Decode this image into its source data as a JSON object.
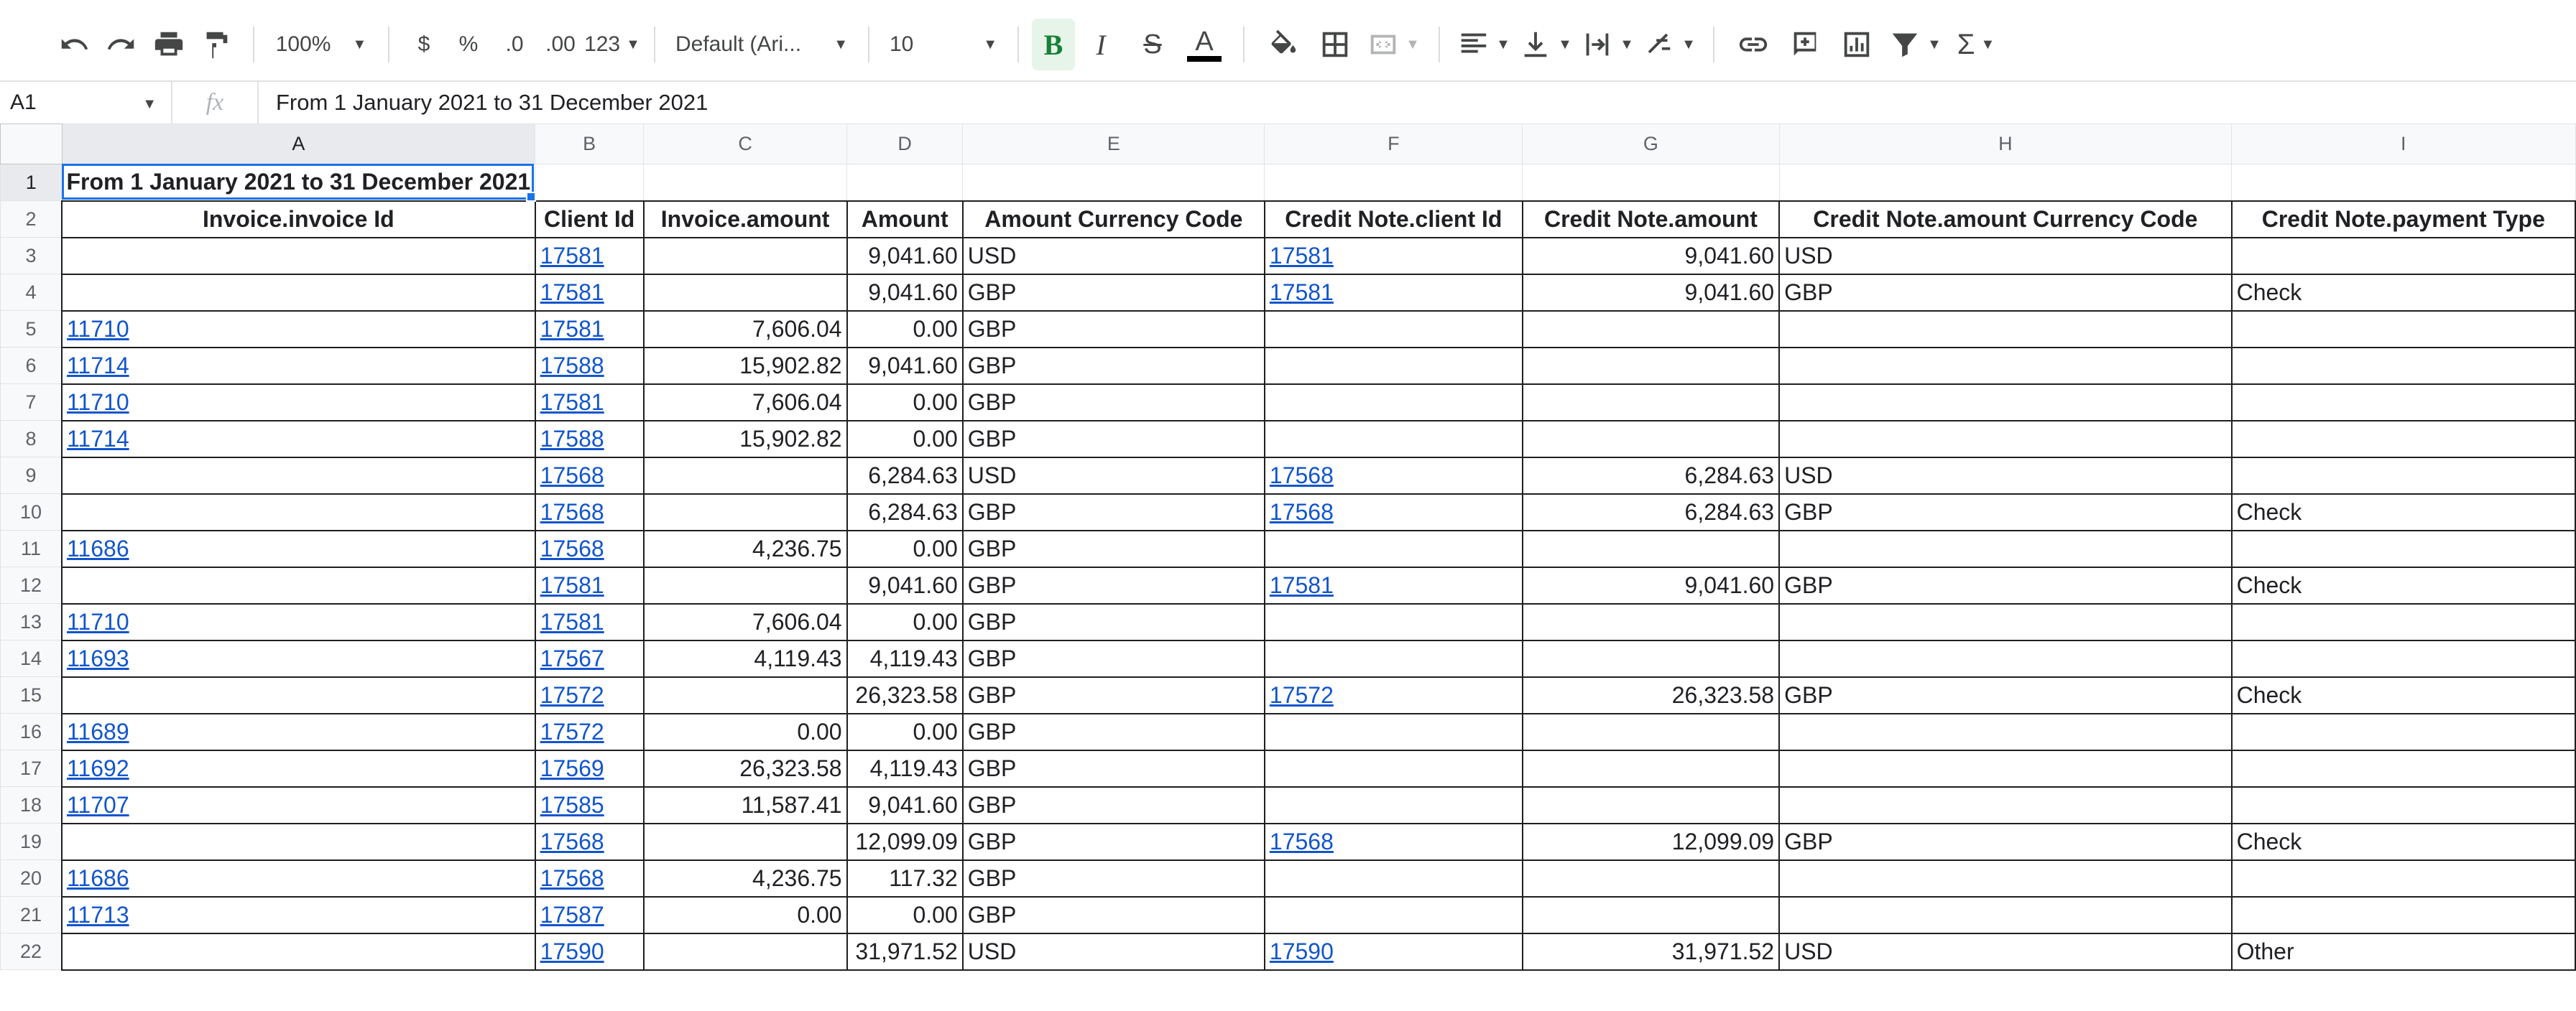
{
  "toolbar": {
    "zoom": "100%",
    "currency": "$",
    "percent": "%",
    "decrease_decimal": ".0",
    "increase_decimal": ".00",
    "more_formats": "123",
    "font": "Default (Ari...",
    "font_size": "10",
    "bold": "B",
    "italic": "I",
    "text_color": "A"
  },
  "formula_bar": {
    "cell_ref": "A1",
    "fx": "fx",
    "content": "From 1 January 2021 to 31 December 2021"
  },
  "columns": [
    "A",
    "B",
    "C",
    "D",
    "E",
    "F",
    "G",
    "H",
    "I"
  ],
  "title": "From 1 January 2021 to 31 December 2021",
  "headers": [
    "Invoice.invoice Id",
    "Client Id",
    "Invoice.amount",
    "Amount",
    "Amount Currency Code",
    "Credit Note.client Id",
    "Credit Note.amount",
    "Credit Note.amount Currency Code",
    "Credit Note.payment Type"
  ],
  "rows": [
    [
      "",
      "17581",
      "",
      "9,041.60",
      "USD",
      "17581",
      "9,041.60",
      "USD",
      ""
    ],
    [
      "",
      "17581",
      "",
      "9,041.60",
      "GBP",
      "17581",
      "9,041.60",
      "GBP",
      "Check"
    ],
    [
      "11710",
      "17581",
      "7,606.04",
      "0.00",
      "GBP",
      "",
      "",
      "",
      ""
    ],
    [
      "11714",
      "17588",
      "15,902.82",
      "9,041.60",
      "GBP",
      "",
      "",
      "",
      ""
    ],
    [
      "11710",
      "17581",
      "7,606.04",
      "0.00",
      "GBP",
      "",
      "",
      "",
      ""
    ],
    [
      "11714",
      "17588",
      "15,902.82",
      "0.00",
      "GBP",
      "",
      "",
      "",
      ""
    ],
    [
      "",
      "17568",
      "",
      "6,284.63",
      "USD",
      "17568",
      "6,284.63",
      "USD",
      ""
    ],
    [
      "",
      "17568",
      "",
      "6,284.63",
      "GBP",
      "17568",
      "6,284.63",
      "GBP",
      "Check"
    ],
    [
      "11686",
      "17568",
      "4,236.75",
      "0.00",
      "GBP",
      "",
      "",
      "",
      ""
    ],
    [
      "",
      "17581",
      "",
      "9,041.60",
      "GBP",
      "17581",
      "9,041.60",
      "GBP",
      "Check"
    ],
    [
      "11710",
      "17581",
      "7,606.04",
      "0.00",
      "GBP",
      "",
      "",
      "",
      ""
    ],
    [
      "11693",
      "17567",
      "4,119.43",
      "4,119.43",
      "GBP",
      "",
      "",
      "",
      ""
    ],
    [
      "",
      "17572",
      "",
      "26,323.58",
      "GBP",
      "17572",
      "26,323.58",
      "GBP",
      "Check"
    ],
    [
      "11689",
      "17572",
      "0.00",
      "0.00",
      "GBP",
      "",
      "",
      "",
      ""
    ],
    [
      "11692",
      "17569",
      "26,323.58",
      "4,119.43",
      "GBP",
      "",
      "",
      "",
      ""
    ],
    [
      "11707",
      "17585",
      "11,587.41",
      "9,041.60",
      "GBP",
      "",
      "",
      "",
      ""
    ],
    [
      "",
      "17568",
      "",
      "12,099.09",
      "GBP",
      "17568",
      "12,099.09",
      "GBP",
      "Check"
    ],
    [
      "11686",
      "17568",
      "4,236.75",
      "117.32",
      "GBP",
      "",
      "",
      "",
      ""
    ],
    [
      "11713",
      "17587",
      "0.00",
      "0.00",
      "GBP",
      "",
      "",
      "",
      ""
    ],
    [
      "",
      "17590",
      "",
      "31,971.52",
      "USD",
      "17590",
      "31,971.52",
      "USD",
      "Other"
    ]
  ]
}
